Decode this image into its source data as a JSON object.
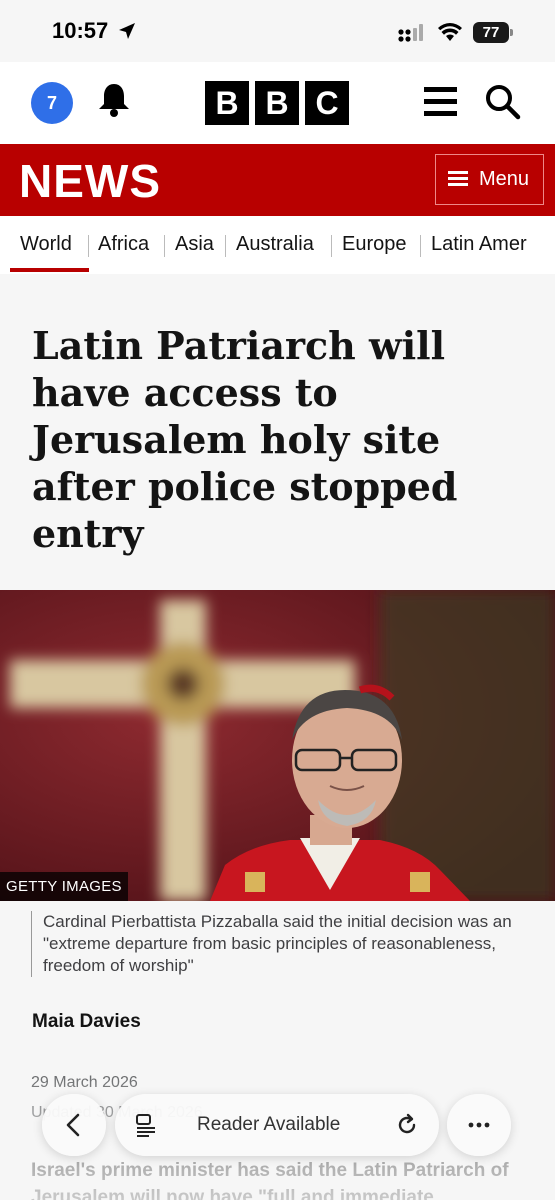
{
  "status_bar": {
    "time": "10:57",
    "battery": "77"
  },
  "top_bar": {
    "notification_count": "7",
    "logo_letters": [
      "B",
      "B",
      "C"
    ]
  },
  "news_bar": {
    "title": "NEWS",
    "menu_label": "Menu"
  },
  "nav": {
    "items": [
      "World",
      "Africa",
      "Asia",
      "Australia",
      "Europe",
      "Latin Amer"
    ],
    "active": "World"
  },
  "article": {
    "headline": "Latin Patriarch will have access to Jerusalem holy site after police stopped entry",
    "image_credit": "GETTY IMAGES",
    "caption": "Cardinal Pierbattista Pizzaballa said the initial decision was an \"extreme departure from basic principles of reasonableness, freedom of worship\"",
    "author": "Maia Davies",
    "date": "29 March 2026",
    "updated": "Updated 30 March 2026",
    "lede": "Israel's prime minister has said the Latin Patriarch of Jerusalem will now have \"full and immediate"
  },
  "browser_toolbar": {
    "reader_label": "Reader Available"
  },
  "colors": {
    "bbc_red": "#b80000",
    "badge_blue": "#2f6fe8"
  }
}
